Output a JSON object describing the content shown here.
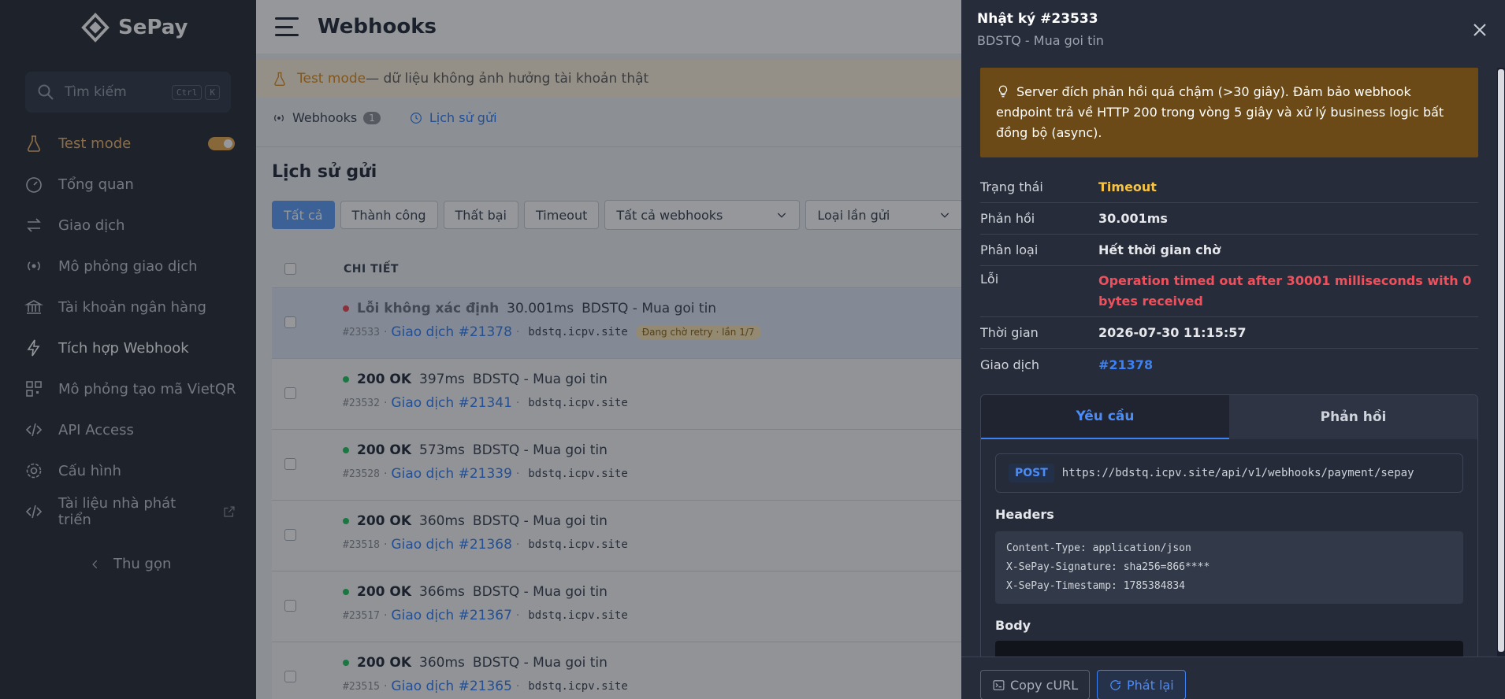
{
  "brand": {
    "name": "SePay"
  },
  "search": {
    "placeholder": "Tìm kiếm",
    "kbd1": "Ctrl",
    "kbd2": "K"
  },
  "sidebar": {
    "items": [
      {
        "label": "Test mode",
        "icon": "flask-icon"
      },
      {
        "label": "Tổng quan",
        "icon": "gauge-icon"
      },
      {
        "label": "Giao dịch",
        "icon": "swap-icon"
      },
      {
        "label": "Mô phỏng giao dịch",
        "icon": "broadcast-icon"
      },
      {
        "label": "Tài khoản ngân hàng",
        "icon": "bank-icon"
      },
      {
        "label": "Tích hợp Webhook",
        "icon": "bolt-icon"
      },
      {
        "label": "Mô phỏng tạo mã VietQR",
        "icon": "qr-icon"
      },
      {
        "label": "API Access",
        "icon": "code-icon"
      },
      {
        "label": "Cấu hình",
        "icon": "gear-icon"
      },
      {
        "label": "Tài liệu nhà phát triển",
        "icon": "code-icon"
      }
    ],
    "collapse_label": "Thu gọn"
  },
  "header": {
    "title": "Webhooks"
  },
  "banner": {
    "mode": "Test mode",
    "text": " — dữ liệu không ảnh hưởng tài khoản thật"
  },
  "tabs": {
    "webhooks": "Webhooks",
    "webhooks_count": "1",
    "history": "Lịch sử gửi"
  },
  "section": {
    "title": "Lịch sử gửi"
  },
  "filters": {
    "chips": [
      "Tất cả",
      "Thành công",
      "Thất bại",
      "Timeout"
    ],
    "select_webhooks": "Tất cả webhooks",
    "select_type": "Loại lần gửi"
  },
  "table": {
    "header": "CHI TIẾT",
    "rows": [
      {
        "status": "Lỗi không xác định",
        "ms": "30.001ms",
        "name": "BDSTQ - Mua goi tin",
        "id": "#23533",
        "tx": "Giao dịch #21378",
        "host": "bdstq.icpv.site",
        "badge": "Đang chờ retry · lần 1/7"
      },
      {
        "status": "200 OK",
        "ms": "397ms",
        "name": "BDSTQ - Mua goi tin",
        "id": "#23532",
        "tx": "Giao dịch #21341",
        "host": "bdstq.icpv.site"
      },
      {
        "status": "200 OK",
        "ms": "573ms",
        "name": "BDSTQ - Mua goi tin",
        "id": "#23528",
        "tx": "Giao dịch #21339",
        "host": "bdstq.icpv.site"
      },
      {
        "status": "200 OK",
        "ms": "360ms",
        "name": "BDSTQ - Mua goi tin",
        "id": "#23518",
        "tx": "Giao dịch #21368",
        "host": "bdstq.icpv.site"
      },
      {
        "status": "200 OK",
        "ms": "366ms",
        "name": "BDSTQ - Mua goi tin",
        "id": "#23517",
        "tx": "Giao dịch #21367",
        "host": "bdstq.icpv.site"
      },
      {
        "status": "200 OK",
        "ms": "360ms",
        "name": "BDSTQ - Mua goi tin",
        "id": "#23515",
        "tx": "Giao dịch #21365",
        "host": "bdstq.icpv.site"
      }
    ]
  },
  "drawer": {
    "title": "Nhật ký #23533",
    "subtitle": "BDSTQ - Mua goi tin",
    "warning": "Server đích phản hồi quá chậm (>30 giây). Đảm bảo webhook endpoint trả về HTTP 200 trong vòng 5 giây và xử lý business logic bất đồng bộ (async).",
    "fields": {
      "status_label": "Trạng thái",
      "status_value": "Timeout",
      "response_label": "Phản hồi",
      "response_value": "30.001ms",
      "type_label": "Phân loại",
      "type_value": "Hết thời gian chờ",
      "error_label": "Lỗi",
      "error_value": "Operation timed out after 30001 milliseconds with 0 bytes received",
      "time_label": "Thời gian",
      "time_value": "2026-07-30 11:15:57",
      "tx_label": "Giao dịch",
      "tx_value": "#21378"
    },
    "tabs": {
      "request": "Yêu cầu",
      "response": "Phản hồi"
    },
    "request": {
      "method": "POST",
      "url": "https://bdstq.icpv.site/api/v1/webhooks/payment/sepay",
      "headers_title": "Headers",
      "headers": [
        "Content-Type: application/json",
        "X-SePay-Signature: sha256=866****",
        "X-SePay-Timestamp: 1785384834"
      ],
      "body_title": "Body"
    },
    "footer": {
      "copy_curl": "Copy cURL",
      "replay": "Phát lại"
    }
  },
  "colors": {
    "accent": "#3b82f6",
    "timeout": "#f6c343",
    "error": "#f0505c",
    "warning_bg": "#6b4a17"
  }
}
